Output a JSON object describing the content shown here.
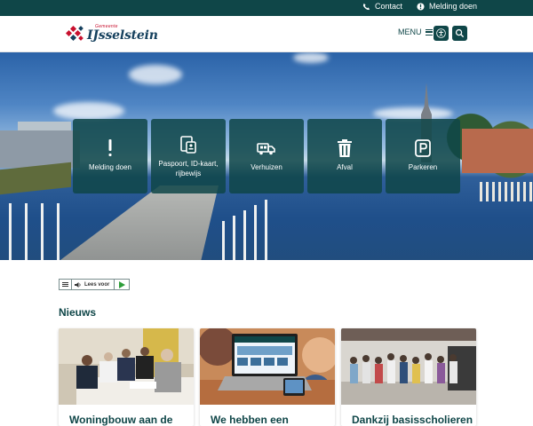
{
  "topbar": {
    "contact_label": "Contact",
    "melding_label": "Melding doen",
    "background": "#0f4648"
  },
  "header": {
    "logo_small": "Gemeente",
    "logo_name": "IJsselstein",
    "menu_label": "MENU"
  },
  "hero": {
    "tiles": [
      {
        "label": "Melding doen",
        "icon": "exclamation-icon"
      },
      {
        "label": "Paspoort, ID-kaart, rijbewijs",
        "icon": "id-card-icon"
      },
      {
        "label": "Verhuizen",
        "icon": "moving-truck-icon"
      },
      {
        "label": "Afval",
        "icon": "trash-icon"
      },
      {
        "label": "Parkeren",
        "icon": "parking-icon"
      }
    ]
  },
  "readaloud": {
    "label": "Lees voor"
  },
  "news": {
    "title": "Nieuws",
    "cards": [
      {
        "headline": "Woningbouw aan de"
      },
      {
        "headline": "We hebben een"
      },
      {
        "headline": "Dankzij basisscholieren"
      }
    ]
  },
  "colors": {
    "primary": "#0f4648",
    "logo_blue": "#16415e",
    "logo_red": "#c8102e"
  }
}
